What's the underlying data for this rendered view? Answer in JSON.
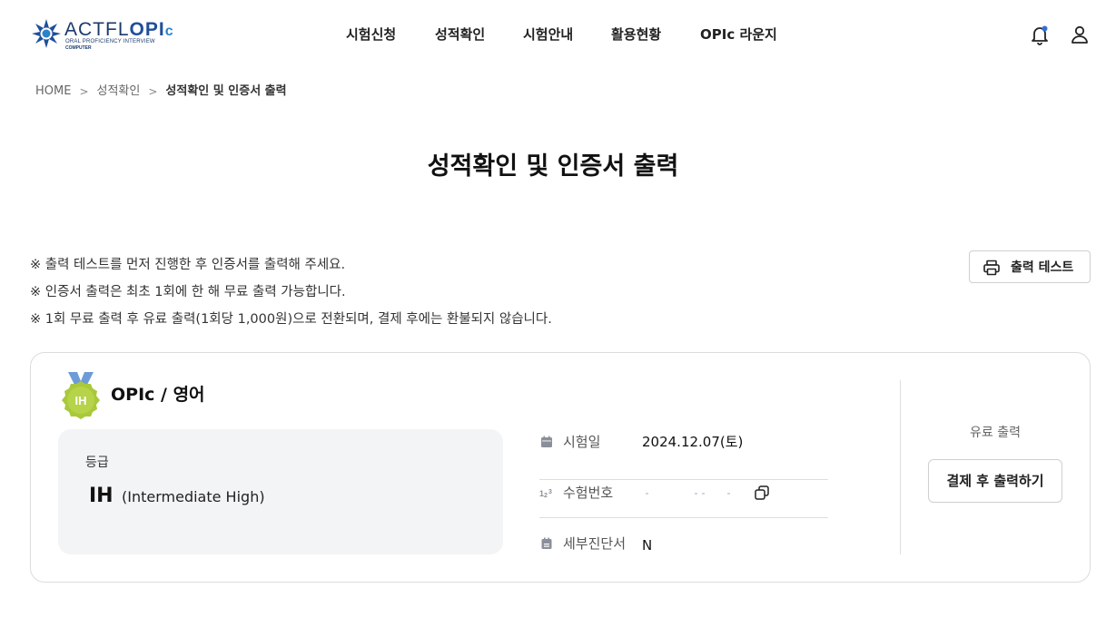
{
  "header": {
    "logo": {
      "brand_prefix": "ACTFL",
      "brand_opi": "OPI",
      "brand_c": "c",
      "subtitle": "ORAL PROFICIENCY INTERVIEW",
      "subtitle2": "COMPUTER"
    },
    "nav": [
      {
        "label": "시험신청"
      },
      {
        "label": "성적확인"
      },
      {
        "label": "시험안내"
      },
      {
        "label": "활용현황"
      },
      {
        "label": "OPIc 라운지"
      }
    ],
    "icons": {
      "notification": "bell-icon",
      "account": "user-icon"
    },
    "notification_dot_color": "#2f6fd6"
  },
  "breadcrumb": {
    "items": [
      "HOME",
      "성적확인",
      "성적확인 및 인증서 출력"
    ],
    "separator": ">"
  },
  "page": {
    "title": "성적확인 및 인증서 출력"
  },
  "notices": [
    "※ 출력 테스트를 먼저 진행한 후 인증서를 출력해 주세요.",
    "※ 인증서 출력은 최초 1회에 한 해 무료 출력 가능합니다.",
    "※ 1회 무료 출력 후 유료 출력(1회당 1,000원)으로 전환되며, 결제 후에는 환불되지 않습니다."
  ],
  "print_test_button": {
    "label": "출력 테스트",
    "icon": "printer-icon"
  },
  "result_card": {
    "badge": {
      "text": "IH",
      "color": "#a9c93a",
      "ribbon_color": "#6d9bd8"
    },
    "exam_name": "OPIc / 영어",
    "grade": {
      "label": "등급",
      "code": "IH",
      "description": "(Intermediate High)"
    },
    "info": [
      {
        "icon": "calendar-icon",
        "key": "시험일",
        "value": "2024.12.07(토)"
      },
      {
        "icon": "number-icon",
        "key": "수험번호",
        "value": ""
      },
      {
        "icon": "document-icon",
        "key": "세부진단서",
        "value": "N"
      }
    ],
    "paid_print": {
      "label": "유료 출력",
      "button_label": "결제 후 출력하기"
    }
  }
}
